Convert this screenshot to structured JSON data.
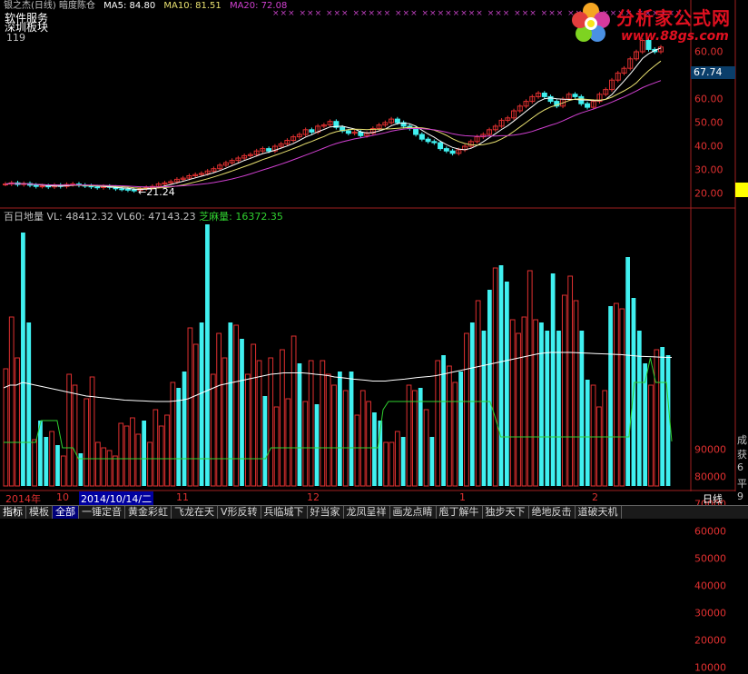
{
  "header": {
    "title": "银之杰(日线) 暗度陈仓",
    "ma5": "MA5: 84.80",
    "ma10": "MA10: 81.51",
    "ma20": "MA20: 72.08",
    "marks": "×××  ××× ××× ×××××  ×××   ××××××××    ×××  ××× ×××  ××  ××××××  ××××××",
    "sector1": "软件服务",
    "sector2": "深圳板块",
    "num": "119"
  },
  "logo": {
    "name": "分析家公式网",
    "url": "www.88gs.com"
  },
  "price_axis": {
    "labels": [
      "60.00",
      "50.00",
      "40.00",
      "30.00",
      "20.00"
    ],
    "current": "67.74",
    "low_label": "←21.24"
  },
  "colors": {
    "up": "#e03030",
    "down": "#40f0f0",
    "ma5": "#ffffff",
    "ma10": "#e8e070",
    "ma20": "#d040d0",
    "vl60": "#ffffff",
    "zhima": "#30d030"
  },
  "volume": {
    "title": "百日地量",
    "vl": "VL: 48412.32",
    "vl60": "VL60: 47143.23",
    "zhima": "芝麻量: 16372.35",
    "axis": [
      "90000",
      "80000",
      "70000",
      "60000",
      "50000",
      "40000",
      "30000",
      "20000",
      "10000"
    ]
  },
  "date_axis": {
    "labels": [
      "2014年",
      "10",
      "11",
      "12",
      "1",
      "2"
    ],
    "selected": "2014/10/14/二",
    "period": "日线"
  },
  "right_panel": {
    "chars": [
      "成",
      "获",
      "6",
      "平",
      "9"
    ]
  },
  "tabs": [
    "指标",
    "模板",
    "全部",
    "一锤定音",
    "黄金彩虹",
    "飞龙在天",
    "V形反转",
    "兵临城下",
    "好当家",
    "龙凤呈祥",
    "画龙点睛",
    "庖丁解牛",
    "独步天下",
    "绝地反击",
    "道破天机"
  ],
  "chart_data": [
    {
      "type": "line",
      "title": "银之杰(日线) 暗度陈仓",
      "ylim": [
        18,
        82
      ],
      "ylabel": "",
      "yticks": [
        20,
        30,
        40,
        50,
        60
      ],
      "close": [
        24,
        24.5,
        23.8,
        24.2,
        23.5,
        23,
        23.2,
        22.8,
        23.5,
        23,
        23.8,
        24,
        23.5,
        23.2,
        22.8,
        22.5,
        23,
        22.6,
        22,
        21.8,
        21.5,
        21.24,
        22,
        22.5,
        23,
        24,
        24.5,
        25,
        26,
        26.5,
        27.5,
        28,
        28.5,
        29.5,
        30.5,
        32,
        33,
        34,
        35,
        36,
        36.5,
        38,
        39,
        38,
        40,
        41,
        42.5,
        44,
        45,
        47,
        46,
        48.5,
        49,
        50.5,
        48,
        46.5,
        45.5,
        46,
        44.5,
        45.5,
        47.5,
        49,
        50,
        51.5,
        50,
        48.5,
        47.5,
        45,
        43,
        42,
        41.5,
        39,
        38,
        37,
        38.5,
        40,
        42,
        44,
        45,
        47,
        48.5,
        51,
        52,
        55,
        57,
        59,
        61,
        62.5,
        61,
        59,
        57,
        60,
        62,
        61,
        58,
        56.5,
        59,
        62,
        64,
        68,
        71,
        73,
        77,
        80,
        84.8,
        81,
        80,
        82
      ]
    },
    {
      "type": "bar",
      "title": "百日地量",
      "ylim": [
        0,
        100000
      ],
      "yticks": [
        10000,
        20000,
        30000,
        40000,
        50000,
        60000,
        70000,
        80000,
        90000
      ],
      "values": [
        43000,
        62000,
        47000,
        93000,
        60000,
        17000,
        24000,
        18000,
        20000,
        15000,
        11000,
        41000,
        37000,
        12000,
        32000,
        40000,
        16000,
        14000,
        13000,
        11000,
        23000,
        22000,
        25000,
        19000,
        24000,
        16000,
        28000,
        22000,
        26000,
        38000,
        36000,
        42000,
        58000,
        52000,
        60000,
        96000,
        41000,
        56000,
        47000,
        60000,
        59000,
        54000,
        41000,
        52000,
        46000,
        33000,
        47000,
        29000,
        50000,
        32000,
        55000,
        45000,
        31000,
        46000,
        30000,
        46000,
        41000,
        37000,
        42000,
        35000,
        42000,
        26000,
        35000,
        31000,
        27000,
        24000,
        16000,
        16000,
        20000,
        18000,
        37000,
        35000,
        36000,
        28000,
        18000,
        46000,
        48000,
        44000,
        38000,
        42000,
        56000,
        60000,
        68000,
        57000,
        72000,
        80000,
        81000,
        75000,
        61000,
        56000,
        62000,
        79000,
        61000,
        60000,
        57000,
        78000,
        57000,
        70000,
        77000,
        68000,
        57000,
        39000,
        37000,
        29000,
        35000,
        66000,
        67000,
        65000,
        84000,
        69000,
        57000,
        45000,
        37000,
        50000,
        51000,
        48000
      ],
      "vl60": [
        36000,
        37000,
        37000,
        38000,
        37500,
        37000,
        36500,
        36000,
        35500,
        35000,
        34500,
        34000,
        33500,
        33000,
        32800,
        32500,
        32300,
        32000,
        31800,
        31500,
        31400,
        31300,
        31200,
        31100,
        31000,
        31000,
        31000,
        31200,
        31500,
        32000,
        33000,
        34000,
        35000,
        36000,
        37000,
        37500,
        38000,
        38500,
        39000,
        39500,
        40000,
        40500,
        41000,
        41200,
        41500,
        41500,
        41500,
        41500,
        41300,
        41000,
        40800,
        40500,
        40000,
        39800,
        39500,
        39200,
        39000,
        38800,
        38500,
        38500,
        38500,
        38800,
        39000,
        39200,
        39500,
        39800,
        40000,
        40200,
        40500,
        41000,
        41500,
        42000,
        42500,
        43000,
        43500,
        44000,
        44500,
        45000,
        45500,
        46000,
        46500,
        47000,
        47500,
        48000,
        48500,
        48800,
        49000,
        49000,
        49000,
        49000,
        48900,
        48800,
        48700,
        48600,
        48500,
        48400,
        48300,
        48200,
        48000,
        47800,
        47600,
        47500,
        47400,
        47300,
        47200,
        47150
      ],
      "zhima": [
        16000,
        16000,
        16000,
        16000,
        16000,
        16000,
        16000,
        24000,
        24000,
        24000,
        24000,
        14000,
        14000,
        14000,
        10000,
        10000,
        10000,
        10000,
        10000,
        10000,
        10000,
        10000,
        10000,
        10000,
        10000,
        10000,
        10000,
        10000,
        10000,
        10000,
        10000,
        10000,
        10000,
        10000,
        10000,
        10000,
        10000,
        10000,
        10000,
        10000,
        10000,
        10000,
        10000,
        10000,
        10000,
        10000,
        10000,
        10000,
        10000,
        10000,
        14000,
        14000,
        14000,
        14000,
        14000,
        14000,
        14000,
        14000,
        14000,
        14000,
        14000,
        14000,
        14000,
        14000,
        14000,
        14000,
        14000,
        14000,
        14000,
        14000,
        14000,
        28000,
        31000,
        31000,
        31000,
        31000,
        31000,
        31000,
        31000,
        31000,
        31000,
        31000,
        31000,
        31000,
        31000,
        31000,
        31000,
        31000,
        31000,
        31000,
        31000,
        31000,
        25000,
        18000,
        18000,
        18000,
        18000,
        18000,
        18000,
        18000,
        18000,
        18000,
        18000,
        18000,
        18000,
        18000,
        18000,
        18000,
        18000,
        18000,
        18000,
        18000,
        18000,
        18000,
        18000,
        18000,
        18000,
        18000,
        38000,
        38000,
        38000,
        47000,
        38000,
        38000,
        38000,
        16372
      ]
    }
  ]
}
